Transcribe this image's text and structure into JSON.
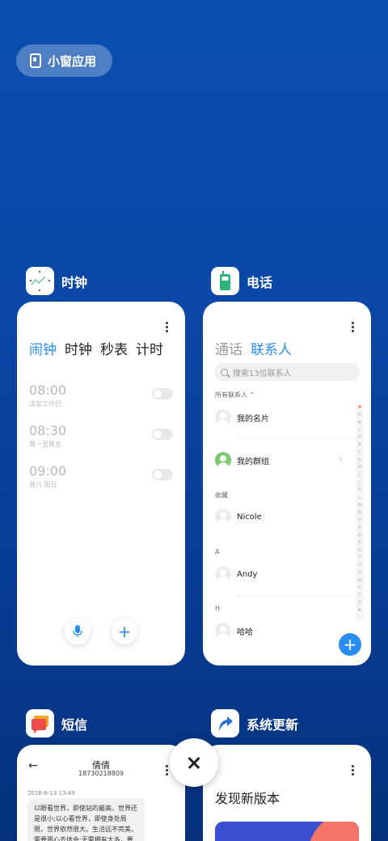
{
  "floating_window_button": {
    "label": "小窗应用"
  },
  "apps": {
    "clock": {
      "name": "时钟",
      "tabs": [
        "闹钟",
        "时钟",
        "秒表",
        "计时"
      ],
      "active_tab": "闹钟",
      "alarms": [
        {
          "time": "08:00",
          "repeat": "法定工作日",
          "enabled": false
        },
        {
          "time": "08:30",
          "repeat": "周一至周五",
          "enabled": false
        },
        {
          "time": "09:00",
          "repeat": "周六 周日",
          "enabled": false
        }
      ],
      "add_glyph": "+"
    },
    "phone": {
      "name": "电话",
      "tabs": [
        "通话",
        "联系人"
      ],
      "active_tab": "联系人",
      "search_placeholder": "搜索13位联系人",
      "all_contacts_label": "所有联系人",
      "my_card": "我的名片",
      "my_groups": "我的群组",
      "favorites_label": "收藏",
      "contacts": [
        {
          "section": "",
          "name": "Nicole"
        },
        {
          "section": "A",
          "name": "Andy"
        },
        {
          "section": "H",
          "name": "哈哈"
        }
      ],
      "index_letters": "♥ABCDEFGHIJKLMNOPQRSTUVWXYZ#",
      "add_glyph": "+"
    },
    "sms": {
      "name": "短信",
      "contact_name": "倩倩",
      "contact_number": "18730218809",
      "date": "2016-6-13 13:49",
      "message": "以眼看世界，即使站的最高，世界还是很小;以心看世界，即使身处局限，世界依然很大。生活远不完美，需要用心去体会;无需拥有太多，要"
    },
    "updater": {
      "name": "系统更新",
      "title": "发现新版本"
    }
  },
  "colors": {
    "accent": "#2a8cf0",
    "background": "#0a47a6"
  }
}
